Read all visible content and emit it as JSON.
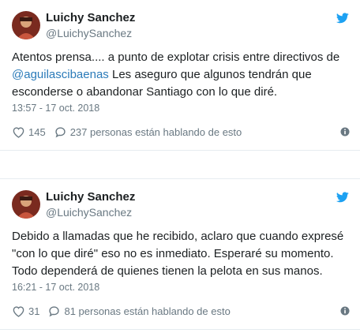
{
  "tweets": [
    {
      "name": "Luichy Sanchez",
      "handle": "@LuichySanchez",
      "lines": [
        {
          "pre": "Atentos prensa.... a punto de explotar crisis entre directivos de",
          "mention": "",
          "post": ""
        },
        {
          "pre": "",
          "mention": "@aguilascibaenas",
          "post": " Les aseguro que algunos tendrán que"
        },
        {
          "pre": "esconderse o abandonar Santiago con lo que diré.",
          "mention": "",
          "post": ""
        }
      ],
      "timestamp": "13:57 - 17 oct. 2018",
      "likes": "145",
      "talking": "237 personas están hablando de esto"
    },
    {
      "name": "Luichy Sanchez",
      "handle": "@LuichySanchez",
      "lines": [
        {
          "pre": "Debido a llamadas que he recibido, aclaro que cuando expresé",
          "mention": "",
          "post": ""
        },
        {
          "pre": "\"con lo que diré\" eso no es inmediato. Esperaré su momento.",
          "mention": "",
          "post": ""
        },
        {
          "pre": "Todo dependerá de quienes tienen la pelota en sus manos.",
          "mention": "",
          "post": ""
        }
      ],
      "timestamp": "16:21 - 17 oct. 2018",
      "likes": "31",
      "talking": "81 personas están hablando de esto"
    }
  ],
  "icons": {
    "bird": "twitter-bird-icon",
    "heart": "heart-icon",
    "reply": "reply-bubble-icon",
    "info": "info-icon"
  },
  "colors": {
    "twitter_blue": "#1da1f2",
    "mention": "#2b7bb9",
    "muted": "#697882",
    "text": "#1c2022"
  }
}
